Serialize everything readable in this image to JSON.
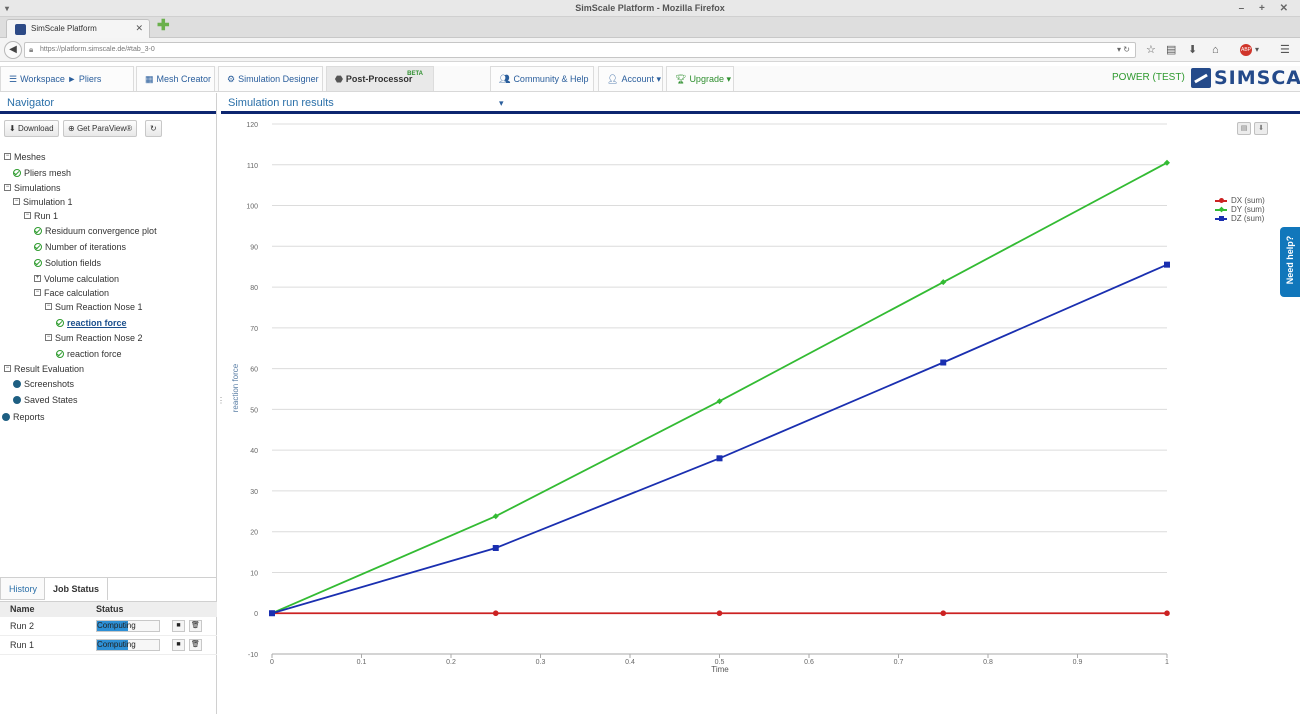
{
  "window": {
    "title": "SimScale Platform - Mozilla Firefox",
    "controls": "– + ✕"
  },
  "browser": {
    "tab_title": "SimScale Platform",
    "url": "https://platform.simscale.de/#tab_3-0"
  },
  "appnav": {
    "breadcrumb": "Workspace ► Pliers",
    "mesh_creator": "Mesh Creator",
    "simulation_designer": "Simulation Designer",
    "post_processor": "Post-Processor",
    "beta_badge": "BETA",
    "community": "Community & Help",
    "account": "Account",
    "upgrade": "Upgrade",
    "plan": "POWER (TEST)",
    "logo": "SIMSCALE"
  },
  "navigator": {
    "title": "Navigator",
    "download": "Download",
    "get_paraview": "Get ParaView®"
  },
  "tree": {
    "meshes": "Meshes",
    "pliers_mesh": "Pliers mesh",
    "simulations": "Simulations",
    "simulation1": "Simulation 1",
    "run1": "Run 1",
    "residuum": "Residuum convergence plot",
    "iterations": "Number of iterations",
    "solution_fields": "Solution fields",
    "volume_calc": "Volume calculation",
    "face_calc": "Face calculation",
    "sum_nose1": "Sum Reaction Nose 1",
    "reaction_force1": "reaction force",
    "sum_nose2": "Sum Reaction Nose 2",
    "reaction_force2": "reaction force",
    "result_eval": "Result Evaluation",
    "screenshots": "Screenshots",
    "saved_states": "Saved States",
    "reports": "Reports"
  },
  "bottom": {
    "tab_history": "History",
    "tab_job_status": "Job Status",
    "col_name": "Name",
    "col_status": "Status",
    "jobs": [
      {
        "name": "Run 2",
        "status": "Computing",
        "progress": 0.5
      },
      {
        "name": "Run 1",
        "status": "Computing",
        "progress": 0.5
      }
    ]
  },
  "results": {
    "title": "Simulation run results",
    "need_help": "Need help?"
  },
  "chart_data": {
    "type": "line",
    "xlabel": "Time",
    "ylabel": "reaction force",
    "xlim": [
      0,
      1
    ],
    "ylim": [
      -10,
      120
    ],
    "xticks": [
      "0",
      "0.1",
      "0.2",
      "0.3",
      "0.4",
      "0.5",
      "0.6",
      "0.7",
      "0.8",
      "0.9",
      "1"
    ],
    "yticks": [
      "-10",
      "0",
      "10",
      "20",
      "30",
      "40",
      "50",
      "60",
      "70",
      "80",
      "90",
      "100",
      "110",
      "120"
    ],
    "x": [
      0,
      0.25,
      0.5,
      0.75,
      1
    ],
    "grid": "horizontal",
    "legend": "right",
    "series": [
      {
        "name": "DX (sum)",
        "color": "#cc2222",
        "marker": "circle",
        "values": [
          0,
          0,
          0,
          0,
          0
        ]
      },
      {
        "name": "DY (sum)",
        "color": "#33bb33",
        "marker": "diamond",
        "values": [
          0,
          23.8,
          52,
          81.2,
          110.5
        ]
      },
      {
        "name": "DZ (sum)",
        "color": "#1a2fb0",
        "marker": "square",
        "values": [
          0,
          16,
          38,
          61.5,
          85.5
        ]
      }
    ]
  }
}
